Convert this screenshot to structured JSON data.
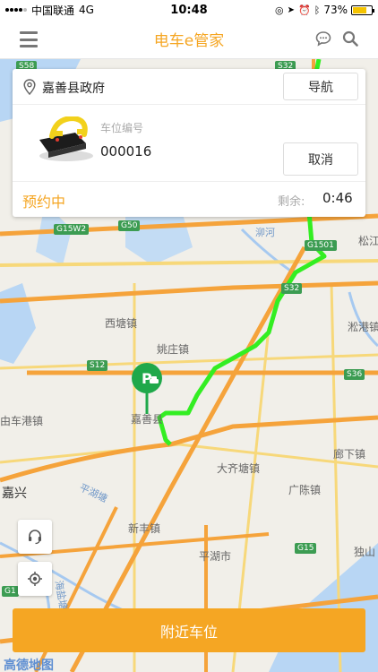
{
  "status_bar": {
    "carrier": "中国联通",
    "network": "4G",
    "time": "10:48",
    "battery": "73%",
    "battery_level": 0.73
  },
  "header": {
    "title": "电车e管家",
    "menu_icon": "menu-icon",
    "chat_icon": "chat-icon",
    "search_icon": "search-icon"
  },
  "card": {
    "location": "嘉善县政府",
    "navigate_label": "导航",
    "spot_label": "车位编号",
    "spot_number": "000016",
    "cancel_label": "取消",
    "status": "预约中",
    "remaining_label": "剩余:",
    "remaining_time": "0:46"
  },
  "map": {
    "labels": [
      "西塘镇",
      "姚庄镇",
      "嘉善县",
      "大齐塘镇",
      "廊下镇",
      "广陈镇",
      "新丰镇",
      "平湖市",
      "独山",
      "淞港镇",
      "嘉兴",
      "松江",
      "泖河",
      "平湖塘",
      "由车港镇",
      "海盐塘"
    ],
    "shields": [
      "S58",
      "S32",
      "G50",
      "G15W2",
      "G1501",
      "S32",
      "S12",
      "S36",
      "G15",
      "G1"
    ],
    "logo": "高德地图",
    "route_color": "#33ee22",
    "parking_color": "#1fa84a"
  },
  "tools": {
    "service_icon": "headset-icon",
    "locate_icon": "locate-icon"
  },
  "bottom": {
    "nearby_label": "附近车位"
  },
  "colors": {
    "accent": "#f5a623"
  }
}
